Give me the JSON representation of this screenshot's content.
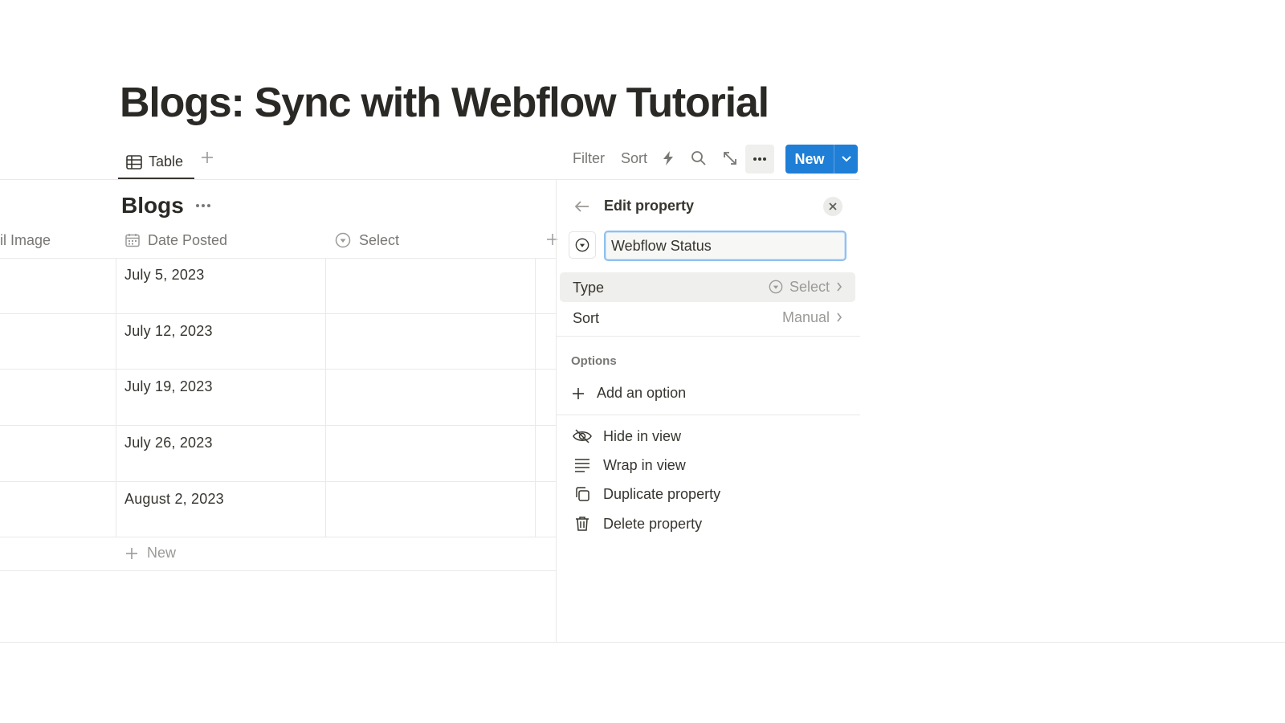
{
  "page": {
    "title": "Blogs: Sync with Webflow Tutorial"
  },
  "views": {
    "tabs": [
      {
        "label": "Table",
        "icon": "table-icon"
      }
    ],
    "add_view_icon": "plus-icon"
  },
  "toolbar": {
    "filter_label": "Filter",
    "sort_label": "Sort",
    "automation_icon": "lightning-icon",
    "search_icon": "search-icon",
    "expand_icon": "expand-icon",
    "more_icon": "more-horizontal-icon",
    "new_label": "New",
    "new_caret_icon": "chevron-down-icon",
    "accent_color": "#1f7ed6"
  },
  "database": {
    "title": "Blogs",
    "columns": [
      {
        "label": "il Image",
        "icon": ""
      },
      {
        "label": "Date Posted",
        "icon": "calendar-icon"
      },
      {
        "label": "Select",
        "icon": "select-icon"
      }
    ],
    "rows": [
      {
        "date_posted": "July 5, 2023",
        "select": ""
      },
      {
        "date_posted": "July 12, 2023",
        "select": ""
      },
      {
        "date_posted": "July 19, 2023",
        "select": ""
      },
      {
        "date_posted": "July 26, 2023",
        "select": ""
      },
      {
        "date_posted": "August 2, 2023",
        "select": ""
      }
    ],
    "new_row_label": "New"
  },
  "edit_property": {
    "title": "Edit property",
    "back_icon": "arrow-left-icon",
    "close_icon": "close-icon",
    "property_icon": "select-icon",
    "name_value": "Webflow Status",
    "type": {
      "label": "Type",
      "value": "Select",
      "value_icon": "select-icon"
    },
    "sort": {
      "label": "Sort",
      "value": "Manual"
    },
    "options_label": "Options",
    "add_option_label": "Add an option",
    "menu": [
      {
        "label": "Hide in view",
        "icon": "eye-off-icon"
      },
      {
        "label": "Wrap in view",
        "icon": "wrap-text-icon"
      },
      {
        "label": "Duplicate property",
        "icon": "duplicate-icon"
      },
      {
        "label": "Delete property",
        "icon": "trash-icon"
      }
    ]
  }
}
